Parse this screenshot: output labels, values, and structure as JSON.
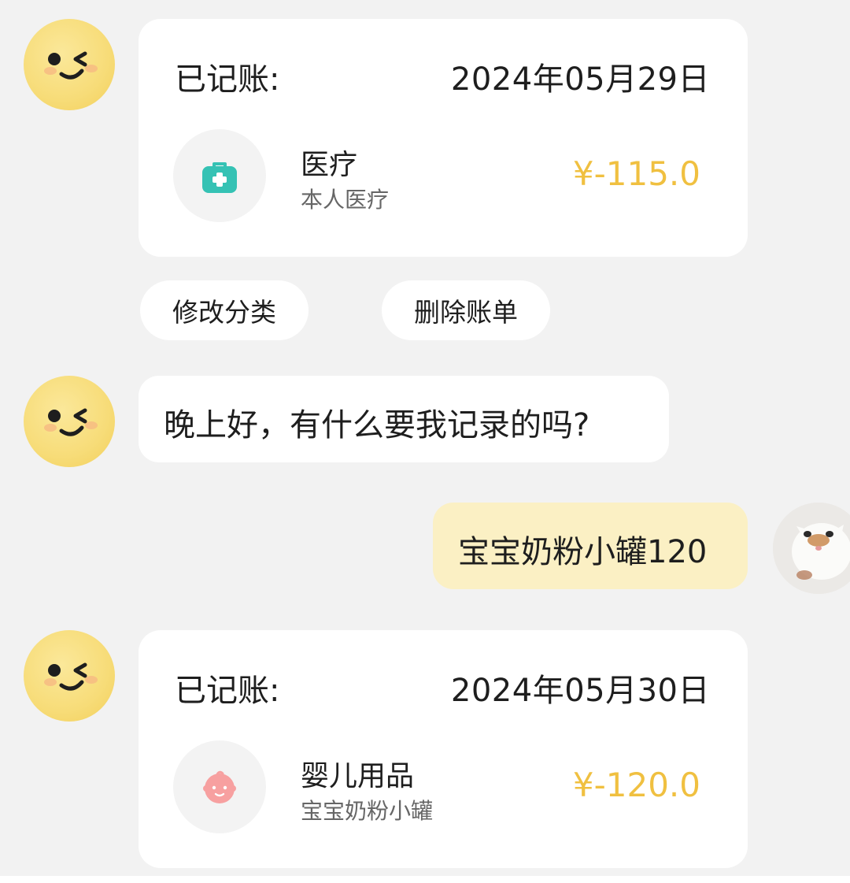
{
  "messages": {
    "bill1": {
      "label": "已记账:",
      "date": "2024年05月29日",
      "category": "医疗",
      "subcategory": "本人医疗",
      "amount": "¥-115.0",
      "icon": "medical-kit-icon"
    },
    "actions": {
      "edit_category": "修改分类",
      "delete_bill": "删除账单"
    },
    "bot_greeting": "晚上好，有什么要我记录的吗?",
    "user_message": "宝宝奶粉小罐120",
    "bill2": {
      "label": "已记账:",
      "date": "2024年05月30日",
      "category": "婴儿用品",
      "subcategory": "宝宝奶粉小罐",
      "amount": "¥-120.0",
      "icon": "baby-face-icon"
    }
  },
  "colors": {
    "background": "#f2f2f2",
    "card": "#ffffff",
    "amount": "#f0c040",
    "user_bubble": "#fbf0c4",
    "bot_avatar": "#f7dc78",
    "medical_icon": "#35c2b4",
    "baby_icon": "#f7a0a0"
  }
}
